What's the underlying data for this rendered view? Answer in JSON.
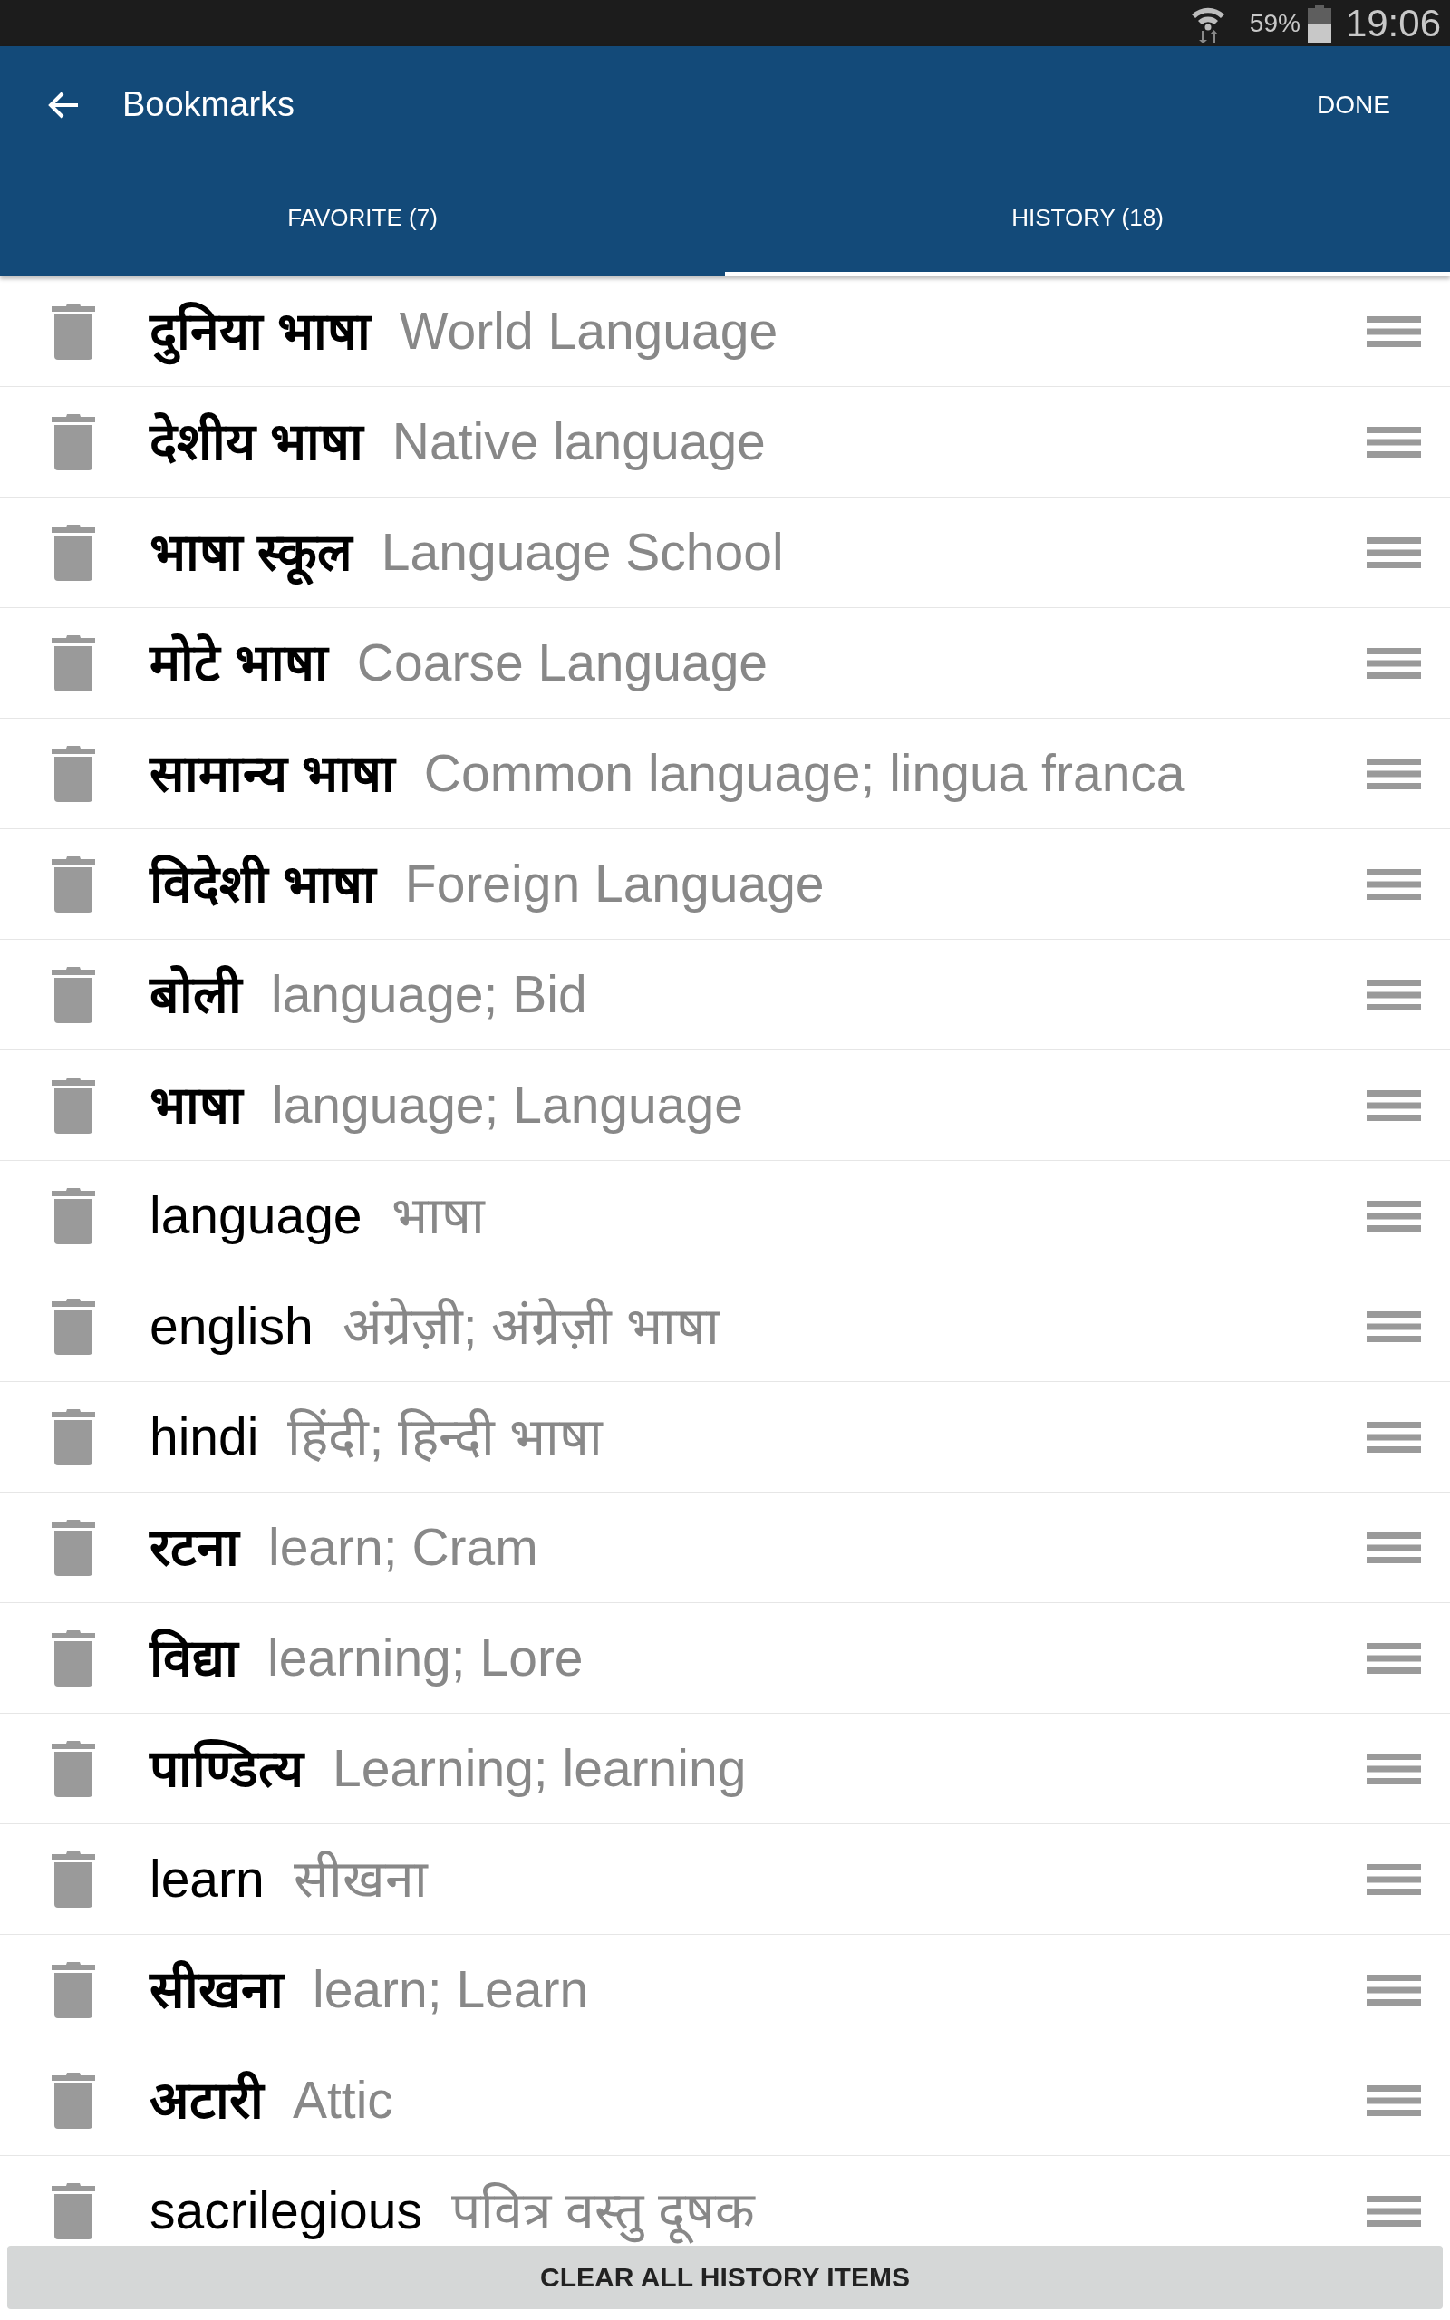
{
  "status_bar": {
    "battery": "59%",
    "time": "19:06"
  },
  "app_bar": {
    "title": "Bookmarks",
    "action": "DONE"
  },
  "tabs": [
    {
      "label": "FAVORITE (7)",
      "selected": false
    },
    {
      "label": "HISTORY (18)",
      "selected": true
    }
  ],
  "entries": [
    {
      "kind": "hindi",
      "word": "दुनिया भाषा",
      "translation": "World Language"
    },
    {
      "kind": "hindi",
      "word": "देशीय भाषा",
      "translation": "Native language"
    },
    {
      "kind": "hindi",
      "word": "भाषा स्कूल",
      "translation": "Language School"
    },
    {
      "kind": "hindi",
      "word": "मोटे भाषा",
      "translation": "Coarse Language"
    },
    {
      "kind": "hindi",
      "word": "सामान्य भाषा",
      "translation": "Common language; lingua franca"
    },
    {
      "kind": "hindi",
      "word": "विदेशी भाषा",
      "translation": "Foreign Language"
    },
    {
      "kind": "hindi",
      "word": "बोली",
      "translation": "language; Bid"
    },
    {
      "kind": "hindi",
      "word": "भाषा",
      "translation": "language; Language"
    },
    {
      "kind": "english",
      "word": "language",
      "translation": "भाषा"
    },
    {
      "kind": "english",
      "word": "english",
      "translation": "अंग्रेज़ी; अंग्रेज़ी भाषा"
    },
    {
      "kind": "english",
      "word": "hindi",
      "translation": "हिंदी; हिन्दी भाषा"
    },
    {
      "kind": "hindi",
      "word": "रटना",
      "translation": "learn; Cram"
    },
    {
      "kind": "hindi",
      "word": "विद्या",
      "translation": "learning; Lore"
    },
    {
      "kind": "hindi",
      "word": "पाण्डित्य",
      "translation": "Learning; learning"
    },
    {
      "kind": "english",
      "word": "learn",
      "translation": "सीखना"
    },
    {
      "kind": "hindi",
      "word": "सीखना",
      "translation": "learn; Learn"
    },
    {
      "kind": "hindi",
      "word": "अटारी",
      "translation": "Attic"
    },
    {
      "kind": "english",
      "word": "sacrilegious",
      "translation": "पवित्र वस्तु दूषक"
    }
  ],
  "footer_button": "CLEAR ALL HISTORY ITEMS"
}
